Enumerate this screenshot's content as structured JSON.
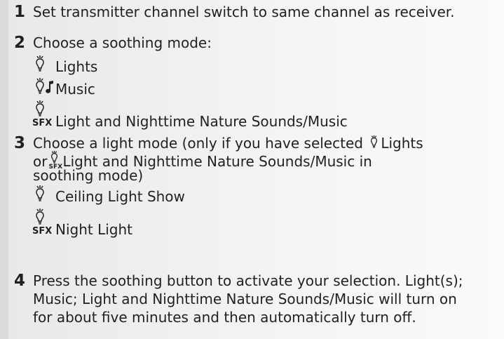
{
  "steps": [
    {
      "number": "1",
      "text": "Set transmitter channel switch to same channel as receiver."
    },
    {
      "number": "2",
      "text": "Choose a soothing mode:",
      "options": [
        {
          "icon": "bulb-icon",
          "label": "Lights"
        },
        {
          "icon": "bulb-music-icon",
          "label": "Music"
        },
        {
          "icon": "bulb-sfx-icon",
          "sfx": "SFX",
          "label": "Light and Nighttime Nature Sounds/Music"
        }
      ]
    },
    {
      "number": "3",
      "line1_a": "Choose a light mode (only if you have selected",
      "line1_b": "Lights",
      "line2_a": "or",
      "line2_sfx": "SFX",
      "line2_b": "Light and Nighttime Nature Sounds/Music in",
      "line3": "soothing mode)",
      "options": [
        {
          "icon": "bulb-icon",
          "label": "Ceiling Light Show"
        },
        {
          "icon": "bulb-sfx-icon",
          "sfx": "SFX",
          "label": "Night Light"
        }
      ]
    },
    {
      "number": "4",
      "line1": "Press the soothing button to activate your selection. Light(s);",
      "line2": "Music; Light and Nighttime Nature Sounds/Music will turn on",
      "line3": "for about five minutes and then automatically turn off."
    }
  ]
}
